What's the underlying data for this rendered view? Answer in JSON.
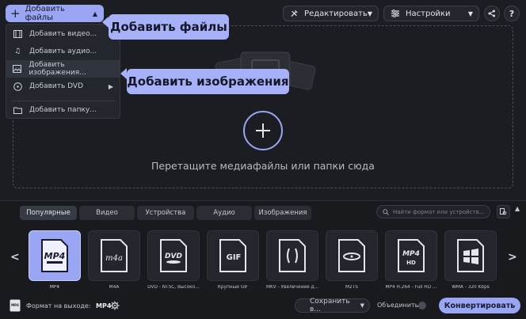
{
  "toolbar": {
    "add_files": "Добавить файлы",
    "edit": "Редактировать",
    "settings": "Настройки"
  },
  "add_menu": {
    "items": [
      {
        "label": "Добавить видео...",
        "icon": "video-icon"
      },
      {
        "label": "Добавить аудио...",
        "icon": "music-note-icon"
      },
      {
        "label": "Добавить изображения...",
        "icon": "image-icon"
      },
      {
        "label": "Добавить DVD",
        "icon": "dvd-icon"
      },
      {
        "label": "Добавить папку...",
        "icon": "folder-icon"
      }
    ]
  },
  "callouts": {
    "add_files": "Добавить файлы",
    "add_images": "Добавить изображения"
  },
  "dropzone": {
    "text": "Перетащите медиафайлы или папки сюда"
  },
  "format_tabs": {
    "tabs": [
      "Популярные",
      "Видео",
      "Устройства",
      "Аудио",
      "Изображения"
    ],
    "active": "Популярные",
    "search_placeholder": "Найти формат или устройств..."
  },
  "formats": [
    {
      "name": "MP4",
      "label": "MP4",
      "selected": true
    },
    {
      "name": "M4A",
      "label": "M4A"
    },
    {
      "name": "DVD",
      "label": "DVD - NTSC, Высоко..."
    },
    {
      "name": "GIF",
      "label": "Крупный GIF"
    },
    {
      "name": "MKV",
      "label": "MKV - Увеличение д..."
    },
    {
      "name": "M2TS",
      "label": "M2TS"
    },
    {
      "name": "MP4 HD",
      "label": "MP4 H.264 - Full HD ..."
    },
    {
      "name": "WMA",
      "label": "WMA - 320 Kbps"
    }
  ],
  "footer": {
    "output_format_label": "Формат на выходе:",
    "output_format_value": "MP4",
    "save_to": "Сохранить в...",
    "join_label": "Объединить:",
    "convert": "Конвертировать"
  },
  "colors": {
    "accent": "#9aa5f4",
    "background": "#1b1d22"
  }
}
